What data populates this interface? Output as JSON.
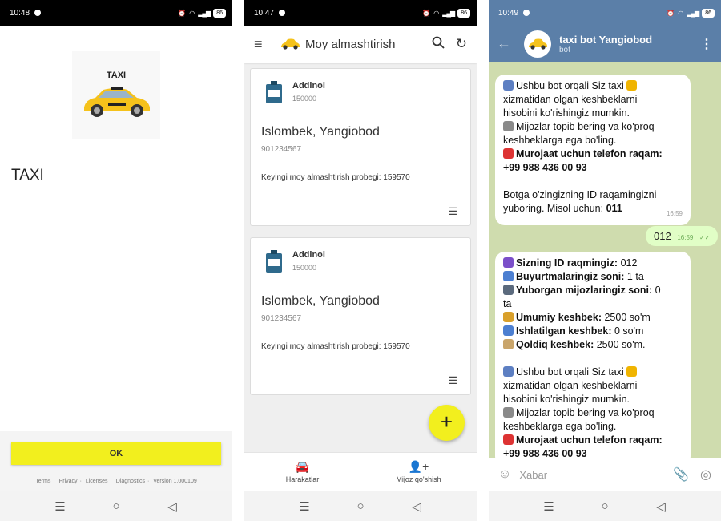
{
  "phone1": {
    "status_time": "10:48",
    "battery": "86",
    "logo_text": "TAXI",
    "title": "TAXI",
    "ok_label": "OK",
    "footer": [
      "Terms",
      "Privacy",
      "Licenses",
      "Diagnostics",
      "Version 1.000109"
    ]
  },
  "phone2": {
    "status_time": "10:47",
    "battery": "86",
    "app_title": "Moy almashtirish",
    "cards": [
      {
        "brand": "Addinol",
        "brand_num": "150000",
        "name": "Islombek, Yangiobod",
        "phone": "901234567",
        "next": "Keyingi moy almashtirish probegi: 159570"
      },
      {
        "brand": "Addinol",
        "brand_num": "150000",
        "name": "Islombek, Yangiobod",
        "phone": "901234567",
        "next": "Keyingi moy almashtirish probegi: 159570"
      }
    ],
    "fab_label": "+",
    "nav": [
      {
        "label": "Harakatlar",
        "icon": "car-icon"
      },
      {
        "label": "Mijoz qo'shish",
        "icon": "add-person-icon"
      }
    ]
  },
  "phone3": {
    "status_time": "10:49",
    "battery": "86",
    "bot_name": "taxi bot Yangiobod",
    "bot_sub": "bot",
    "msg1": {
      "l1": "Ushbu bot orqali Siz taxi",
      "l2": "xizmatidan olgan keshbeklarni",
      "l3": "hisobini ko'rishingiz mumkin.",
      "l4": "Mijozlar topib bering va ko'proq",
      "l5": "keshbeklarga ega bo'ling.",
      "l6": "Murojaat uchun telefon raqam:",
      "l7": "+99 988 436 00 93",
      "l8": "Botga o'zingizning ID raqamingizni",
      "l9": "yuboring. Misol uchun:",
      "l9b": "011",
      "time": "16:59"
    },
    "out_msg": {
      "text": "012",
      "time": "16:59"
    },
    "msg2": {
      "id_label": "Sizning ID raqmingiz:",
      "id_val": "012",
      "orders_label": "Buyurtmalaringiz soni:",
      "orders_val": "1 ta",
      "clients_label": "Yuborgan mijozlaringiz soni:",
      "clients_val": "0",
      "clients_tail": "ta",
      "total_label": "Umumiy keshbek:",
      "total_val": "2500 so'm",
      "used_label": "Ishlatilgan keshbek:",
      "used_val": "0 so'm",
      "rest_label": "Qoldiq keshbek:",
      "rest_val": "2500 so'm.",
      "l1": "Ushbu bot orqali Siz taxi",
      "l2": "xizmatidan olgan keshbeklarni",
      "l3": "hisobini ko'rishingiz mumkin.",
      "l4": "Mijozlar topib bering va ko'proq",
      "l5": "keshbeklarga ega bo'ling.",
      "l6": "Murojaat uchun telefon raqam:",
      "l7": "+99 988 436 00 93"
    },
    "input_placeholder": "Xabar"
  },
  "colors": {
    "accent_yellow": "#f2ef1e",
    "telegram_header": "#5b7fa8",
    "chat_bg": "#cfdcae"
  }
}
